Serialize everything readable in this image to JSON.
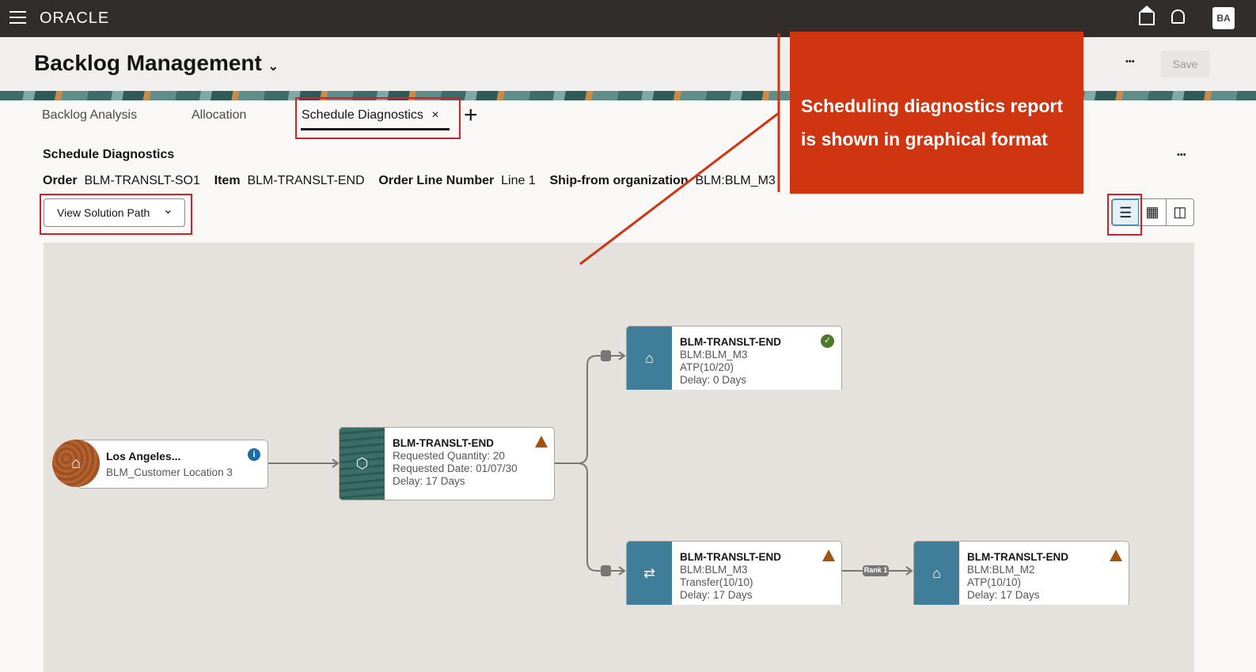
{
  "topbar": {
    "brand": "ORACLE",
    "avatar": "BA"
  },
  "header": {
    "title": "Backlog Management",
    "save": "Save",
    "more": "•••"
  },
  "tabs": [
    {
      "label": "Backlog Analysis"
    },
    {
      "label": "Allocation"
    },
    {
      "label": "Schedule Diagnostics",
      "close": "×"
    }
  ],
  "add_tab": "+",
  "section": {
    "title": "Schedule Diagnostics",
    "more": "•••",
    "fields": [
      {
        "label": "Order",
        "value": "BLM-TRANSLT-SO1"
      },
      {
        "label": "Item",
        "value": "BLM-TRANSLT-END"
      },
      {
        "label": "Order Line Number",
        "value": "Line 1"
      },
      {
        "label": "Ship-from organization",
        "value": "BLM:BLM_M3"
      }
    ],
    "view_select": "View Solution Path"
  },
  "callout": {
    "line1": "Scheduling diagnostics report",
    "line2": "is shown in graphical format"
  },
  "diagram": {
    "customer": {
      "title": "Los Angeles...",
      "sub": "BLM_Customer Location 3"
    },
    "demand": {
      "title": "BLM-TRANSLT-END",
      "l1": "Requested Quantity: 20",
      "l2": "Requested Date: 01/07/30",
      "l3": "Delay: 17 Days"
    },
    "node_a": {
      "title": "BLM-TRANSLT-END",
      "l1": "BLM:BLM_M3",
      "l2": "ATP(10/20)",
      "l3": "Delay: 0 Days"
    },
    "node_b": {
      "title": "BLM-TRANSLT-END",
      "l1": "BLM:BLM_M3",
      "l2": "Transfer(10/10)",
      "l3": "Delay: 17 Days"
    },
    "node_c": {
      "title": "BLM-TRANSLT-END",
      "l1": "BLM:BLM_M2",
      "l2": "ATP(10/10)",
      "l3": "Delay: 17 Days"
    },
    "rank": "Rank 1",
    "edge_label": "..."
  },
  "colors": {
    "callout": "#d03511",
    "accent": "#3f7d98",
    "warning": "#a3530e",
    "success": "#4b7a28"
  }
}
